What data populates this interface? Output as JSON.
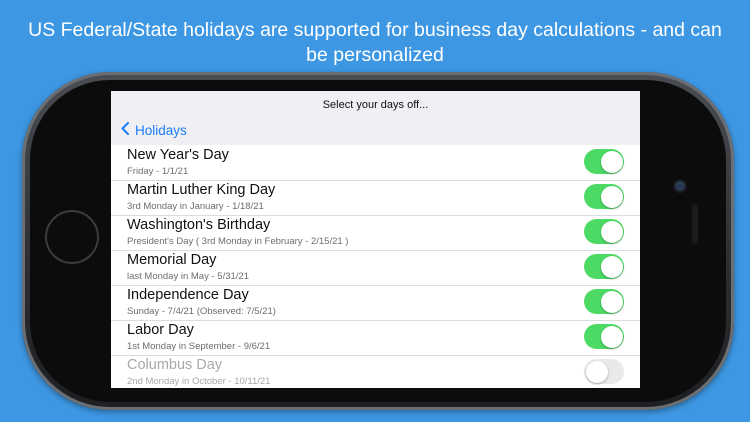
{
  "headline": "US Federal/State holidays are supported for business day calculations - and can be personalized",
  "nav": {
    "prompt": "Select your days off...",
    "back_label": "Holidays",
    "back_icon": "chevron-left-icon"
  },
  "holidays": [
    {
      "title": "New Year's Day",
      "subtitle": "Friday - 1/1/21",
      "enabled": true
    },
    {
      "title": "Martin Luther King Day",
      "subtitle": "3rd Monday in January - 1/18/21",
      "enabled": true
    },
    {
      "title": "Washington's Birthday",
      "subtitle": "President's Day ( 3rd Monday in February - 2/15/21 )",
      "enabled": true
    },
    {
      "title": "Memorial Day",
      "subtitle": "last Monday in May - 5/31/21",
      "enabled": true
    },
    {
      "title": "Independence Day",
      "subtitle": "Sunday - 7/4/21 (Observed: 7/5/21)",
      "enabled": true
    },
    {
      "title": "Labor Day",
      "subtitle": "1st Monday in September - 9/6/21",
      "enabled": true
    },
    {
      "title": "Columbus Day",
      "subtitle": "2nd Monday in October - 10/11/21",
      "enabled": false
    }
  ],
  "colors": {
    "background": "#3d97e3",
    "toggle_on": "#4cd964",
    "toggle_off": "#e9e9ea",
    "link": "#1a7cf5"
  }
}
